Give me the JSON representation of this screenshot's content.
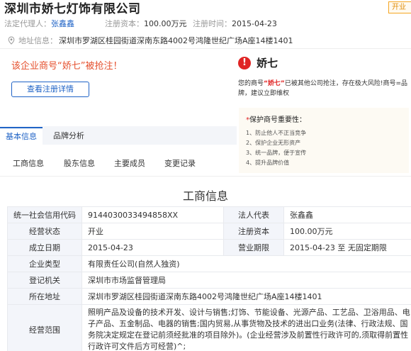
{
  "company": {
    "name": "深圳市娇七灯饰有限公司",
    "status": "开业"
  },
  "meta": {
    "legal_rep_label": "法定代理人：",
    "legal_rep_value": "张鑫鑫",
    "capital_label": "注册资本：",
    "capital_value": "100.00万元",
    "date_label": "注册时间：",
    "date_value": "2015-04-23"
  },
  "address": {
    "label": "地址信息：",
    "value": "深圳市罗湖区桂园街道深南东路4002号鸿隆世纪广场A座14楼1401"
  },
  "warning": {
    "text": "该企业商号“娇七”被抢注！",
    "button": "查看注册详情"
  },
  "alert": {
    "name": "娇七",
    "desc_prefix": "您的商号",
    "desc_highlight": "“娇七”",
    "desc_suffix": "已被其他公司抢注，存在极大风险!商号=品牌，建议立即维权"
  },
  "protect": {
    "title": "保护商号重要性：",
    "items": [
      "1、防止他人不正当竞争",
      "2、保护企业无形资产",
      "3、统一品牌，便于宣传",
      "4、提升品牌价值"
    ]
  },
  "tabs": [
    "基本信息",
    "品牌分析"
  ],
  "subtabs": [
    "工商信息",
    "股东信息",
    "主要成员",
    "变更记录"
  ],
  "section_title": "工商信息",
  "table": {
    "credit_code_label": "统一社会信用代码",
    "credit_code": "914403003349485​8XX",
    "legal_rep_label": "法人代表",
    "legal_rep": "张鑫鑫",
    "status_label": "经营状态",
    "status": "开业",
    "capital_label": "注册资本",
    "capital": "100.00万元",
    "founded_label": "成立日期",
    "founded": "2015-04-23",
    "term_label": "营业期限",
    "term": "2015-04-23 至 无固定期限",
    "type_label": "企业类型",
    "type": "有限责任公司(自然人独资)",
    "authority_label": "登记机关",
    "authority": "深圳市市场监督管理局",
    "address_label": "所在地址",
    "address": "深圳市罗湖区桂园街道深南东路4002号鸿隆世纪广场A座14楼1401",
    "scope_label": "经营范围",
    "scope": "照明产品及设备的技术开发、设计与销售;灯饰、节能设备、光源产品、工艺品、卫浴用品、电子产品、五金制品、电器的销售;国内贸易,从事货物及技术的进出口业务(法律、行政法规、国务院决定规定在登记前须经批准的项目除外)。(企业经营涉及前置性行政许可的,须取得前置性行政许可文件后方可经营)^;"
  },
  "colors": {
    "accent": "#1f63c6",
    "warning": "#e5502e",
    "danger": "#e02424",
    "status_tag": "#f5a623"
  }
}
